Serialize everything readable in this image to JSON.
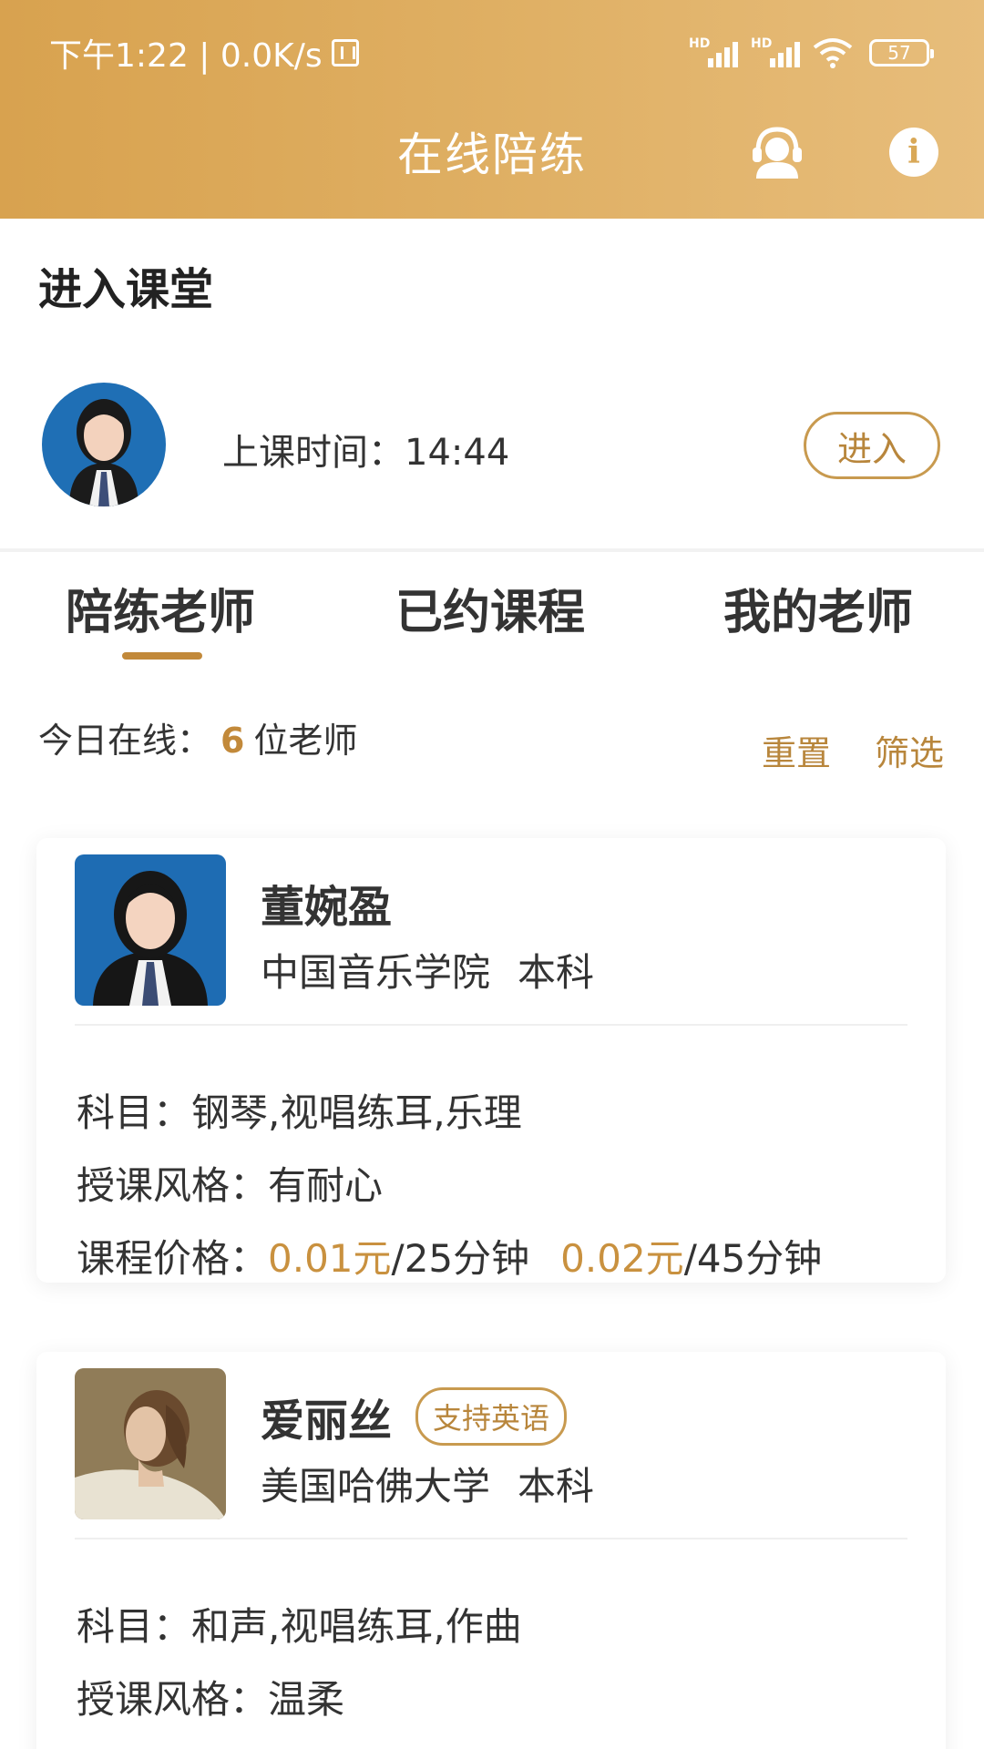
{
  "status_bar": {
    "time_speed": "下午1:22 | 0.0K/s",
    "battery": "57"
  },
  "header": {
    "title": "在线陪练"
  },
  "enter_class": {
    "section_title": "进入课堂",
    "time_label": "上课时间：",
    "time_value": "14:44",
    "enter_button": "进入"
  },
  "tabs": [
    {
      "label": "陪练老师",
      "active": true
    },
    {
      "label": "已约课程",
      "active": false
    },
    {
      "label": "我的老师",
      "active": false
    }
  ],
  "online": {
    "prefix": "今日在线：",
    "count": "6",
    "suffix": "位老师",
    "reset": "重置",
    "filter": "筛选"
  },
  "teachers": [
    {
      "name": "董婉盈",
      "badge": "",
      "school": "中国音乐学院",
      "degree": "本科",
      "subject_label": "科目：",
      "subjects": "钢琴,视唱练耳,乐理",
      "style_label": "授课风格：",
      "style": "有耐心",
      "price_label": "课程价格：",
      "price1": "0.01元",
      "duration1": "/25分钟",
      "price2": "0.02元",
      "duration2": "/45分钟"
    },
    {
      "name": "爱丽丝",
      "badge": "支持英语",
      "school": "美国哈佛大学",
      "degree": "本科",
      "subject_label": "科目：",
      "subjects": "和声,视唱练耳,作曲",
      "style_label": "授课风格：",
      "style": "温柔"
    }
  ]
}
